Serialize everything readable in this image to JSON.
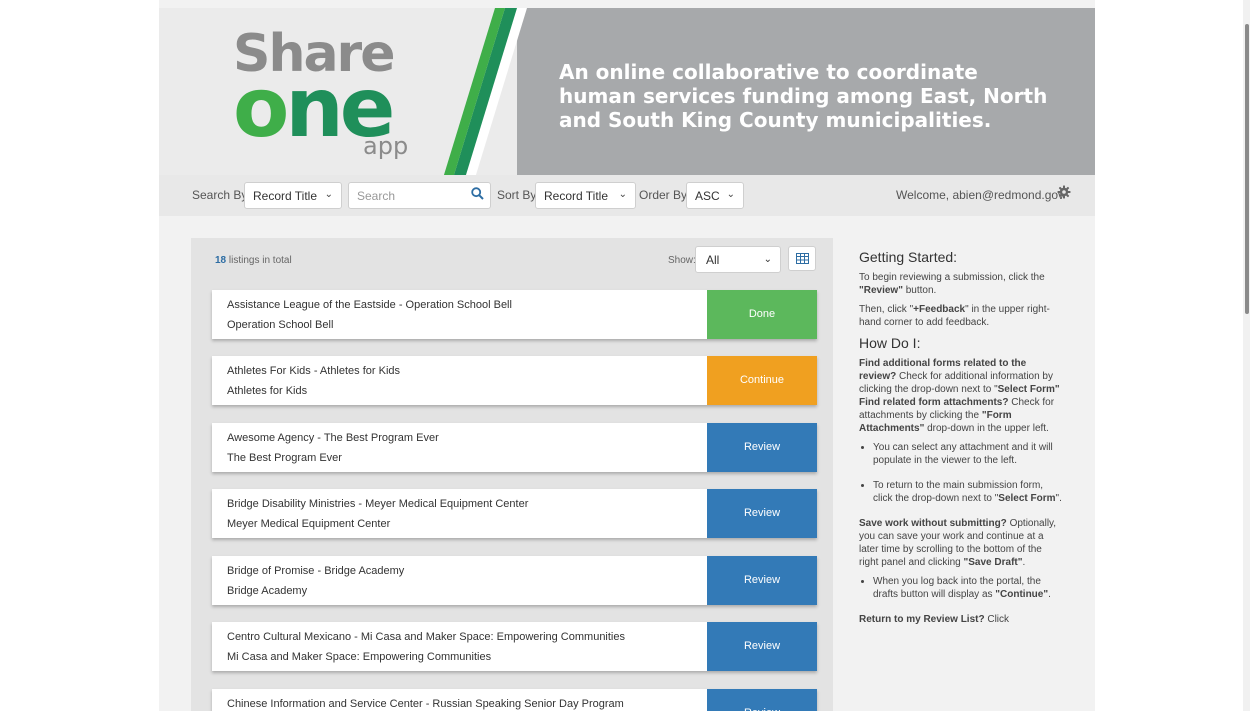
{
  "banner": {
    "logo": {
      "share": "Share",
      "one_o": "o",
      "one_ne": "ne",
      "app": "app"
    },
    "tagline": "An online collaborative to coordinate human services funding among East, North and South King County municipalities.",
    "colors": {
      "green": "#3fae49",
      "dark_green": "#1f8f5a",
      "grey": "#a7a9ab"
    }
  },
  "toolbar": {
    "search_by_label": "Search By",
    "search_by_value": "Record Title",
    "search_placeholder": "Search",
    "sort_by_label": "Sort By",
    "sort_by_value": "Record Title",
    "order_by_label": "Order By",
    "order_by_value": "ASC",
    "welcome": "Welcome, abien@redmond.gov",
    "search_icon": "search-icon",
    "settings_icon": "gear-icon"
  },
  "listing": {
    "count": "18",
    "count_suffix": " listings in total",
    "show_label": "Show:",
    "show_value": "All",
    "colors": {
      "done": "#5cb85c",
      "continue": "#f0a020",
      "review": "#337ab7"
    },
    "items": [
      {
        "title": "Assistance League of the Eastside - Operation School Bell",
        "subtitle": "Operation School Bell",
        "action": "Done",
        "status": "done"
      },
      {
        "title": "Athletes For Kids - Athletes for Kids",
        "subtitle": "Athletes for Kids",
        "action": "Continue",
        "status": "continue"
      },
      {
        "title": "Awesome Agency - The Best Program Ever",
        "subtitle": "The Best Program Ever",
        "action": "Review",
        "status": "review"
      },
      {
        "title": "Bridge Disability Ministries - Meyer Medical Equipment Center",
        "subtitle": "Meyer Medical Equipment Center",
        "action": "Review",
        "status": "review"
      },
      {
        "title": "Bridge of Promise - Bridge Academy",
        "subtitle": "Bridge Academy",
        "action": "Review",
        "status": "review"
      },
      {
        "title": "Centro Cultural Mexicano - Mi Casa and Maker Space: Empowering Communities",
        "subtitle": "Mi Casa and Maker Space: Empowering Communities",
        "action": "Review",
        "status": "review"
      },
      {
        "title": "Chinese Information and Service Center - Russian Speaking Senior Day Program",
        "subtitle": "",
        "action": "Review",
        "status": "review"
      }
    ]
  },
  "help": {
    "getting_started": "Getting Started:",
    "gs_p1_a": "To begin reviewing a submission, click the ",
    "gs_p1_b": "\"Review\"",
    "gs_p1_c": " button.",
    "gs_p2_a": "Then, click \"",
    "gs_p2_b": "+Feedback",
    "gs_p2_c": "\" in the upper right-hand corner to add feedback.",
    "how_do_i": "How Do I:",
    "find_forms_q": "Find additional forms related to the review?",
    "find_forms_a": " Check for additional information by clicking the drop-down next to \"",
    "select_form": "Select Form",
    "find_attach_q": "\" Find related form attachments?",
    "find_attach_a": " Check for attachments by clicking the ",
    "form_attachments": "\"Form Attachments\"",
    "find_attach_c": " drop-down in the upper left.",
    "bullet1": "You can select any attachment and it will populate in the viewer to the left.",
    "bullet2_a": "To return to the main submission form, click the drop-down next to \"",
    "bullet2_b": "Select Form",
    "bullet2_c": "\".",
    "save_q": "Save work without submitting?",
    "save_a": " Optionally, you can save your work and continue at a later time by scrolling to the bottom of the right panel and clicking ",
    "save_draft": "\"Save Draft\"",
    "save_c": ".",
    "bullet3_a": "When you log back into the portal, the drafts button will display as ",
    "bullet3_b": "\"Continue\"",
    "bullet3_c": ".",
    "return_q": "Return to my Review List?",
    "return_a": " Click"
  }
}
